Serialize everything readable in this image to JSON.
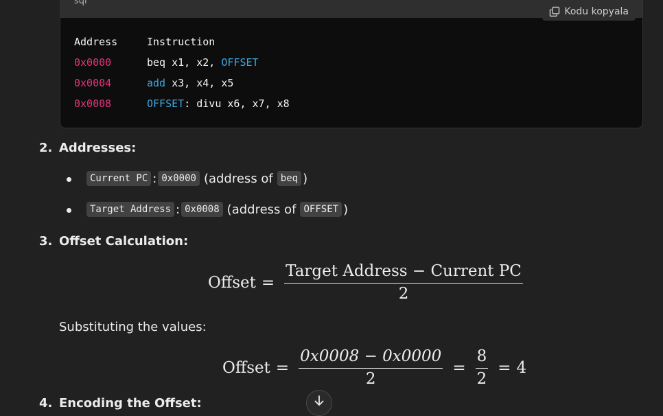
{
  "code_block": {
    "language": "sql",
    "copy_label": "Kodu kopyala",
    "header": {
      "address": "Address",
      "instruction": "Instruction"
    },
    "rows": [
      {
        "address": "0x0000",
        "pre": "beq x1, x2, ",
        "kw": "OFFSET",
        "post": ""
      },
      {
        "address": "0x0004",
        "pre": "",
        "kw": "add",
        "post": " x3, x4, x5"
      },
      {
        "address": "0x0008",
        "pre": "",
        "kw": "OFFSET",
        "post": ": divu x6, x7, x8"
      }
    ]
  },
  "steps": [
    {
      "number": "2.",
      "title": "Addresses:",
      "bullets": [
        {
          "code1": "Current PC",
          "sep": ":",
          "code2": "0x0000",
          "text": "(address of",
          "code3": "beq",
          "close": ")"
        },
        {
          "code1": "Target Address",
          "sep": ":",
          "code2": "0x0008",
          "text": "(address of",
          "code3": "OFFSET",
          "close": ")"
        }
      ]
    },
    {
      "number": "3.",
      "title": "Offset Calculation:",
      "formula1": {
        "lhs": "Offset",
        "eq": "=",
        "numerator": "Target Address − Current PC",
        "denominator": "2"
      },
      "substituting_text": "Substituting the values:",
      "formula2": {
        "lhs": "Offset",
        "eq": "=",
        "numerator": "0x0008 − 0x0000",
        "denominator": "2",
        "eq2": "=",
        "num2": "8",
        "den2": "2",
        "eq3": "=",
        "result": "4"
      }
    },
    {
      "number": "4.",
      "title": "Encoding the Offset:"
    }
  ],
  "icons": {
    "copy": "copy-icon",
    "scroll": "arrow-down-icon"
  }
}
